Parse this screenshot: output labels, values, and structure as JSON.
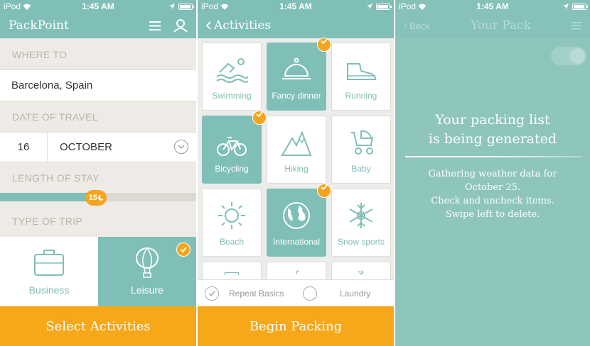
{
  "status": {
    "carrier": "iPod",
    "time": "1:45 AM"
  },
  "screen1": {
    "app_title": "PackPoint",
    "where_label": "WHERE TO",
    "destination": "Barcelona, Spain",
    "date_label": "DATE OF TRAVEL",
    "day": "16",
    "month": "OCTOBER",
    "length_label": "LENGTH OF STAY",
    "length_value": "15",
    "length_fill_fraction": 0.49,
    "type_label": "TYPE OF TRIP",
    "trip_types": [
      {
        "label": "Business",
        "selected": false
      },
      {
        "label": "Leisure",
        "selected": true
      }
    ],
    "cta": "Select Activities"
  },
  "screen2": {
    "back_label": "Activities",
    "activities": [
      {
        "label": "Swimming",
        "icon": "swimming-icon",
        "selected": false
      },
      {
        "label": "Fancy dinner",
        "icon": "cloche-icon",
        "selected": true
      },
      {
        "label": "Running",
        "icon": "shoe-icon",
        "selected": false
      },
      {
        "label": "Bicycling",
        "icon": "bicycle-icon",
        "selected": true
      },
      {
        "label": "Hiking",
        "icon": "mountain-icon",
        "selected": false
      },
      {
        "label": "Baby",
        "icon": "stroller-icon",
        "selected": false
      },
      {
        "label": "Beach",
        "icon": "sun-icon",
        "selected": false
      },
      {
        "label": "International",
        "icon": "globe-icon",
        "selected": true
      },
      {
        "label": "Snow sports",
        "icon": "snowflake-icon",
        "selected": false
      }
    ],
    "repeat_basics": "Repeat Basics",
    "laundry": "Laundry",
    "cta": "Begin Packing"
  },
  "screen3": {
    "back_label": "Back",
    "title": "Your Pack",
    "heading_line1": "Your packing list",
    "heading_line2": "is being generated",
    "info_line1": "Gathering weather data for",
    "info_line2": "October 25.",
    "info_line3": "Check and uncheck items.",
    "info_line4": "Swipe left to delete."
  },
  "colors": {
    "teal": "#7fbfb7",
    "orange": "#f6a71a"
  }
}
